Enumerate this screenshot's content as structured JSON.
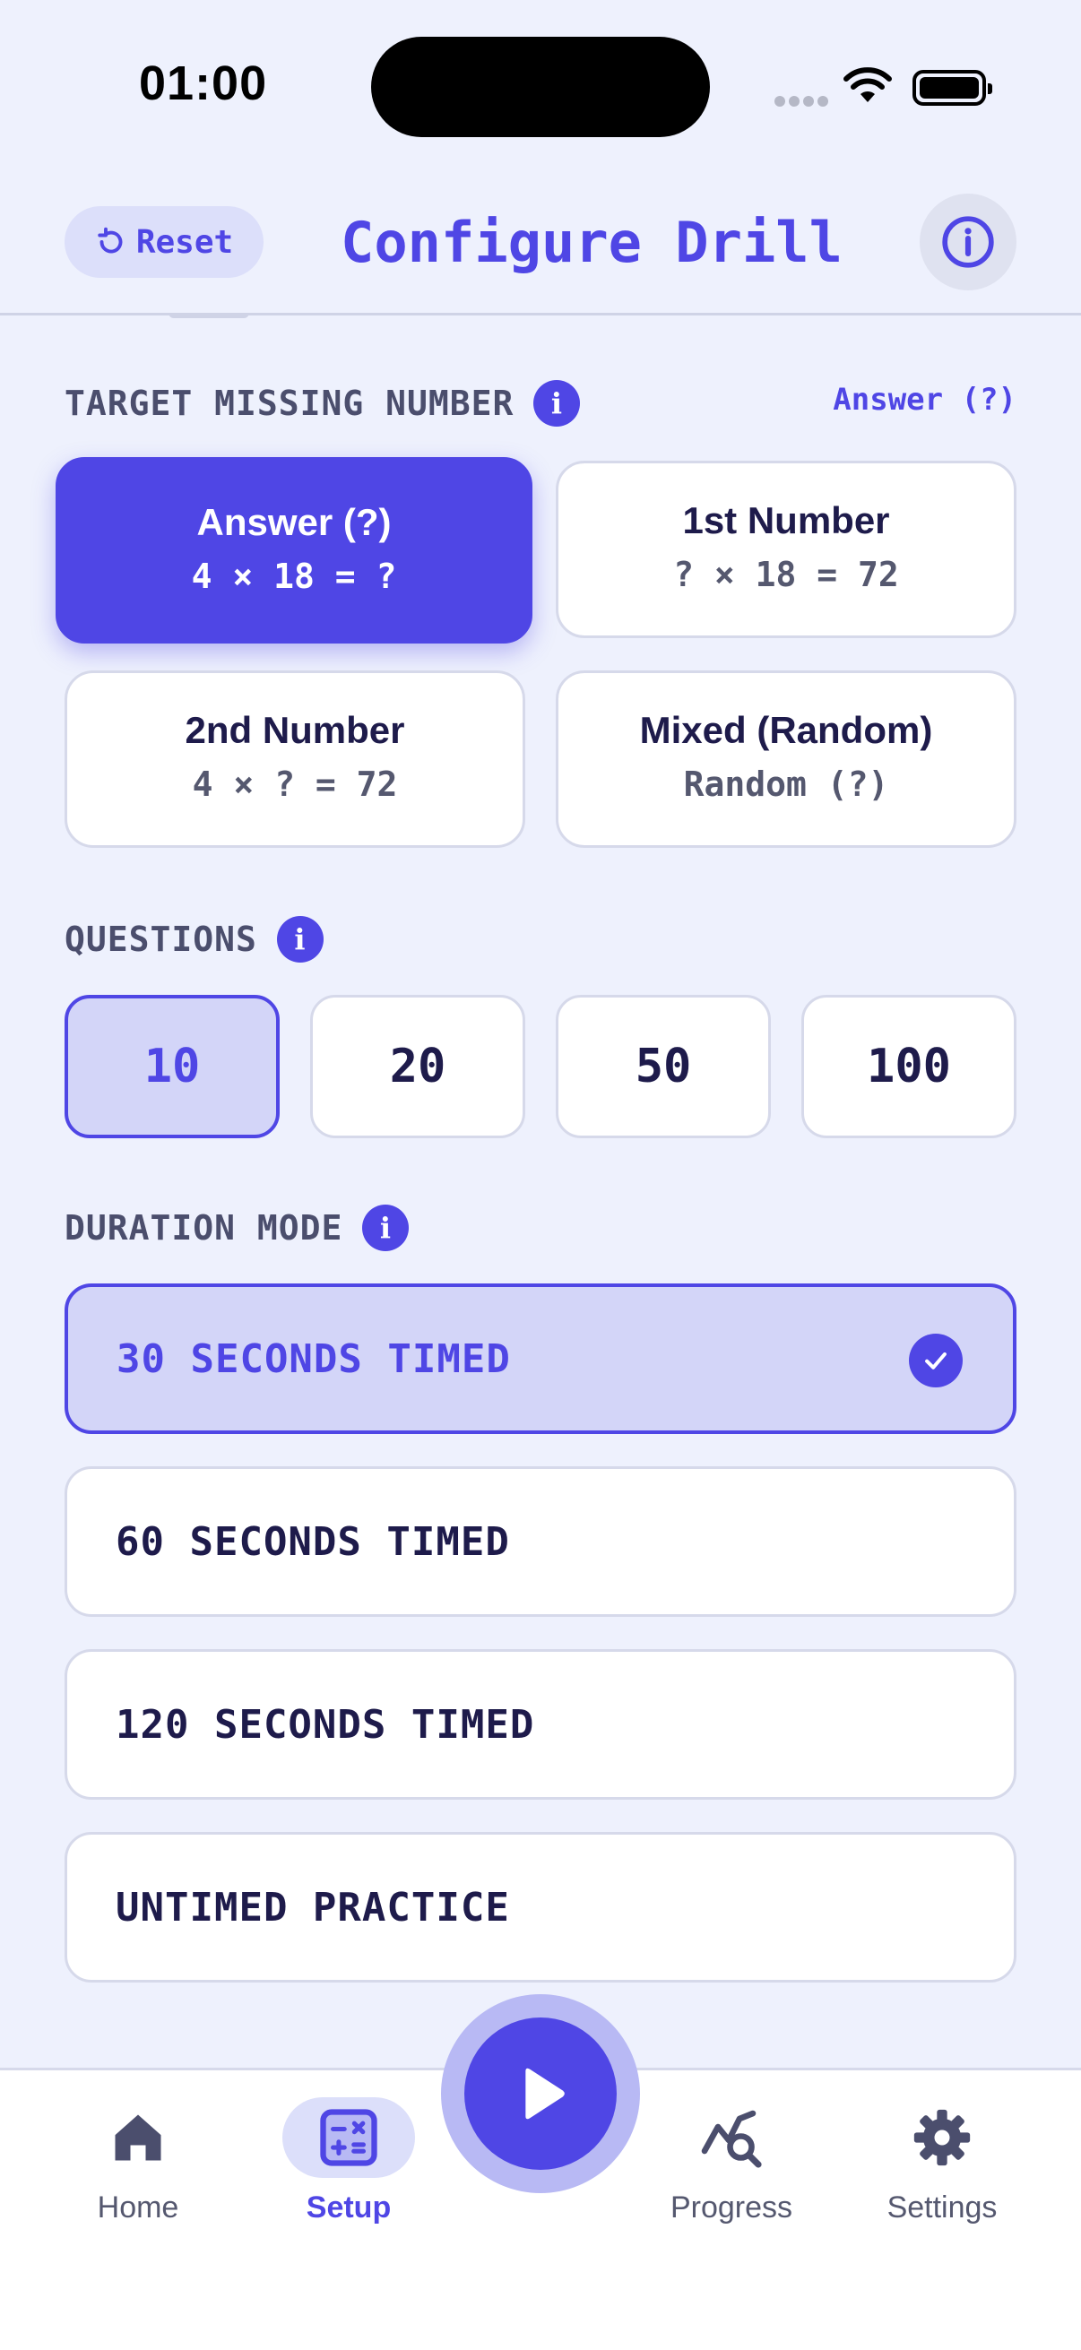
{
  "status_bar": {
    "time": "01:00"
  },
  "header": {
    "reset_label": "Reset",
    "title": "Configure Drill"
  },
  "target": {
    "label": "TARGET MISSING NUMBER",
    "current": "Answer (?)",
    "options": [
      {
        "label": "Answer (?)",
        "example": "4 × 18 = ?",
        "selected": true
      },
      {
        "label": "1st Number",
        "example": "? × 18 = 72",
        "selected": false
      },
      {
        "label": "2nd Number",
        "example": "4 × ? = 72",
        "selected": false
      },
      {
        "label": "Mixed (Random)",
        "example": "Random (?)",
        "selected": false
      }
    ]
  },
  "questions": {
    "label": "QUESTIONS",
    "options": [
      "10",
      "20",
      "50",
      "100"
    ],
    "selected": "10"
  },
  "duration": {
    "label": "DURATION MODE",
    "options": [
      "30 SECONDS TIMED",
      "60 SECONDS TIMED",
      "120 SECONDS TIMED",
      "UNTIMED PRACTICE"
    ],
    "selected": "30 SECONDS TIMED"
  },
  "nav": {
    "items": [
      {
        "label": "Home",
        "icon": "home-icon"
      },
      {
        "label": "Setup",
        "icon": "calculator-icon",
        "active": true
      },
      {
        "label": "Progress",
        "icon": "chart-search-icon"
      },
      {
        "label": "Settings",
        "icon": "gear-icon"
      }
    ],
    "play_icon": "play-icon"
  },
  "colors": {
    "accent": "#4f46e5",
    "background": "#eef1fd",
    "selected_fill": "#d3d5f8"
  }
}
